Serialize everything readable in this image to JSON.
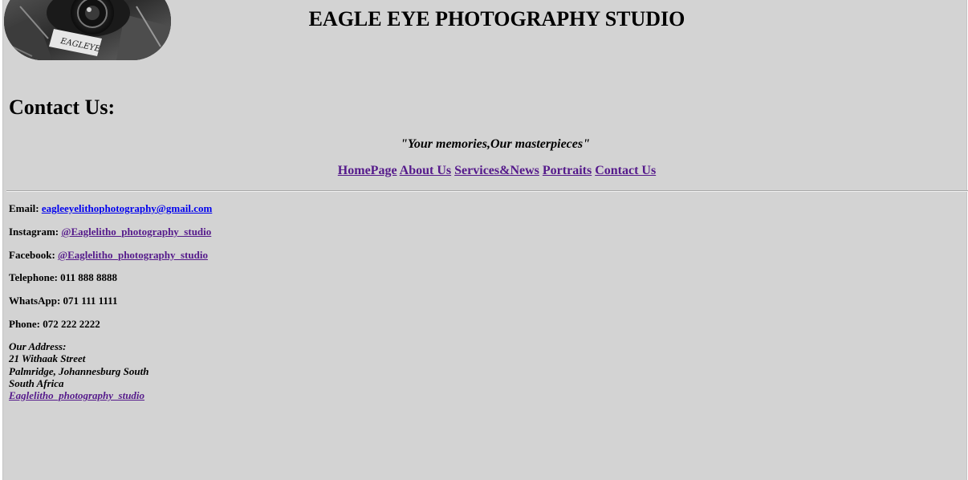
{
  "header": {
    "title": "EAGLE EYE PHOTOGRAPHY STUDIO",
    "logo_text": "EAGLEYE"
  },
  "page_heading": "Contact Us:",
  "tagline": "\"Your memories,Our masterpieces\"",
  "nav": [
    {
      "label": "HomePage"
    },
    {
      "label": "About Us"
    },
    {
      "label": "Services&News"
    },
    {
      "label": "Portraits"
    },
    {
      "label": "Contact Us"
    }
  ],
  "contact": {
    "email_label": "Email:",
    "email_value": "eagleeyelithophotography@gmail.com",
    "instagram_label": "Instagram:",
    "instagram_value": "@Eaglelitho_photography_studio",
    "facebook_label": "Facebook:",
    "facebook_value": "@Eaglelitho_photography_studio",
    "telephone": "Telephone: 011 888 8888",
    "whatsapp": "WhatsApp: 071 111 1111",
    "phone": "Phone: 072 222 2222"
  },
  "address": {
    "label": "Our Address:",
    "line1": "21 Withaak Street",
    "line2": "Palmridge, Johannesburg South",
    "line3": "South Africa",
    "link": "Eaglelitho_photography_studio"
  },
  "colors": {
    "background": "#d3d3d3",
    "link_unvisited": "#0000ee",
    "link_visited": "#551a8b"
  }
}
